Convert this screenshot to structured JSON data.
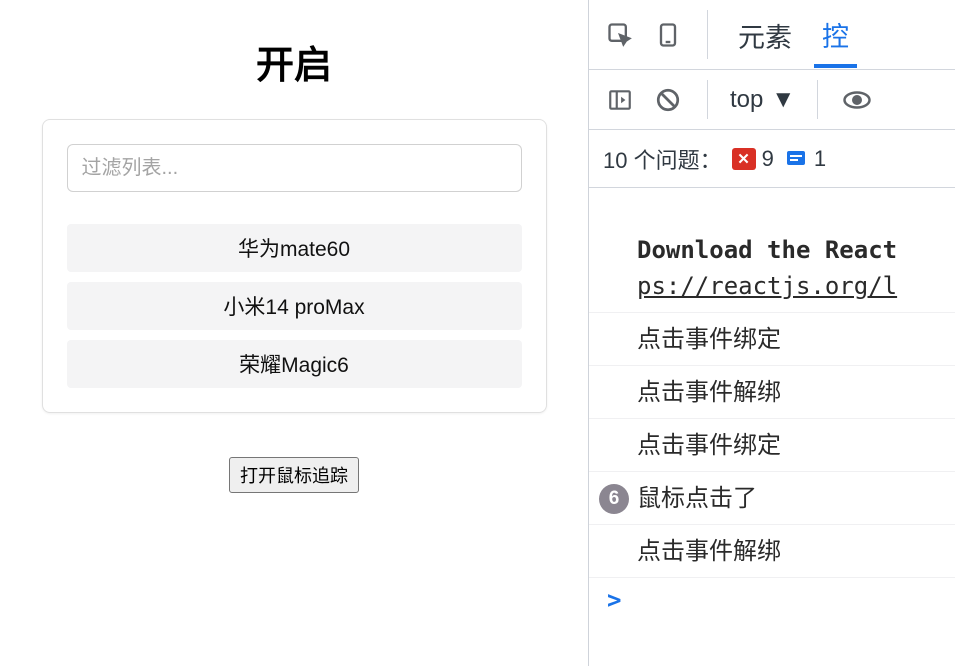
{
  "app": {
    "title": "开启",
    "filter_placeholder": "过滤列表...",
    "items": [
      {
        "label": "华为mate60"
      },
      {
        "label": "小米14 proMax"
      },
      {
        "label": "荣耀Magic6"
      }
    ],
    "track_button": "打开鼠标追踪"
  },
  "devtools": {
    "tabs": {
      "elements": "元素",
      "console": "控"
    },
    "top_selector": "top",
    "issues": {
      "label": "10 个问题：",
      "errors": "9",
      "info": "1"
    },
    "console": {
      "head1": "Download the React",
      "head2": "ps://reactjs.org/l",
      "lines": [
        {
          "text": "点击事件绑定"
        },
        {
          "text": "点击事件解绑"
        },
        {
          "text": "点击事件绑定"
        },
        {
          "text": "鼠标点击了",
          "count": "6"
        },
        {
          "text": "点击事件解绑"
        }
      ],
      "prompt": ">"
    }
  }
}
